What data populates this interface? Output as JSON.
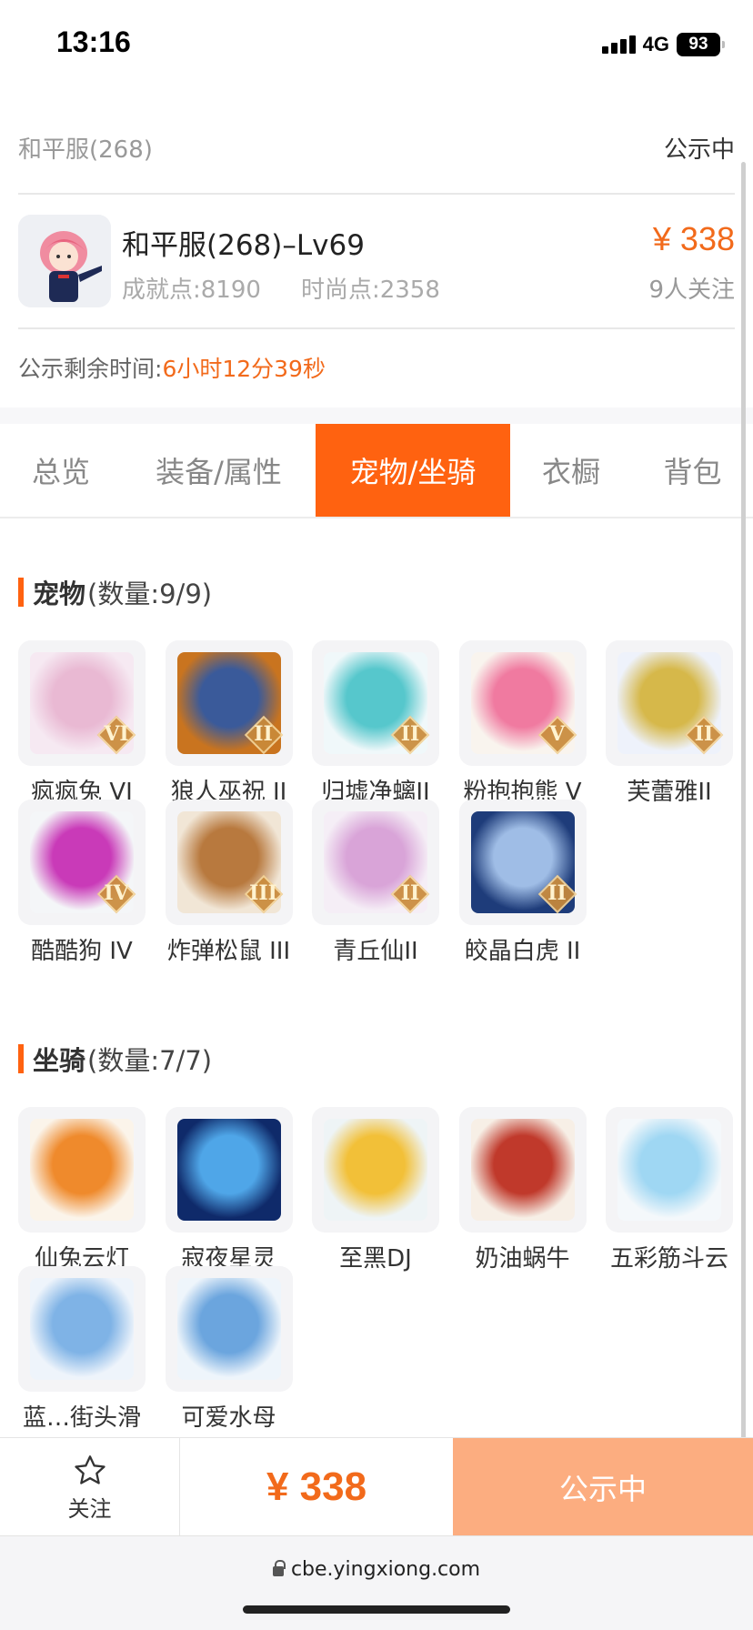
{
  "status_bar": {
    "time": "13:16",
    "network": "4G",
    "battery": "93"
  },
  "listing": {
    "server": "和平服(268)",
    "status": "公示中",
    "character": {
      "name": "和平服(268)–Lv69",
      "achievement_points": "成就点:8190",
      "fashion_points": "时尚点:2358",
      "price": "¥ 338",
      "followers": "9人关注"
    },
    "remaining_label": "公示剩余时间:",
    "remaining_value": "6小时12分39秒"
  },
  "tabs": [
    {
      "label": "总览",
      "active": false
    },
    {
      "label": "装备/属性",
      "active": false
    },
    {
      "label": "宠物/坐骑",
      "active": true
    },
    {
      "label": "衣橱",
      "active": false
    },
    {
      "label": "背包",
      "active": false
    }
  ],
  "pets": {
    "title": "宠物",
    "count": "(数量:9/9)",
    "items": [
      {
        "name": "疯疯兔 VI",
        "badge": "VI",
        "icon": "pink-rabbit-icon",
        "colors": [
          "#f6e9f2",
          "#e9b9d3"
        ]
      },
      {
        "name": "狼人巫祝 II",
        "badge": "II",
        "icon": "werewolf-shaman-icon",
        "colors": [
          "#c9741f",
          "#3a5a9a"
        ]
      },
      {
        "name": "归墟净螭II",
        "badge": "II",
        "icon": "jade-dragon-icon",
        "colors": [
          "#f0f8fa",
          "#56c7cc"
        ]
      },
      {
        "name": "粉抱抱熊 V",
        "badge": "V",
        "icon": "pink-bear-icon",
        "colors": [
          "#f9f4ee",
          "#f07aa0"
        ]
      },
      {
        "name": "芙蕾雅II",
        "badge": "II",
        "icon": "valkyrie-icon",
        "colors": [
          "#eef2fb",
          "#d6b84a"
        ]
      },
      {
        "name": "酷酷狗 IV",
        "badge": "IV",
        "icon": "cool-dog-icon",
        "colors": [
          "#f4f6f8",
          "#c93ab8"
        ]
      },
      {
        "name": "炸弹松鼠 III",
        "badge": "III",
        "icon": "bomb-squirrel-icon",
        "colors": [
          "#f1e6d6",
          "#b8793e"
        ]
      },
      {
        "name": "青丘仙II",
        "badge": "II",
        "icon": "fox-fairy-icon",
        "colors": [
          "#f5eef6",
          "#d9a4d8"
        ]
      },
      {
        "name": "皎晶白虎 II",
        "badge": "II",
        "icon": "white-tiger-icon",
        "colors": [
          "#1e3c7a",
          "#9fbde6"
        ]
      }
    ]
  },
  "mounts": {
    "title": "坐骑",
    "count": "(数量:7/7)",
    "items": [
      {
        "name": "仙兔云灯",
        "icon": "rabbit-lantern-icon",
        "colors": [
          "#fbf4ea",
          "#ef8a2c"
        ]
      },
      {
        "name": "寂夜星灵",
        "icon": "night-star-deer-icon",
        "colors": [
          "#0f2a6a",
          "#4fa6e8"
        ]
      },
      {
        "name": "至黑DJ",
        "icon": "dj-penguin-icon",
        "colors": [
          "#eef4f6",
          "#f2c038"
        ]
      },
      {
        "name": "奶油蜗牛",
        "icon": "cream-snail-icon",
        "colors": [
          "#f7efe6",
          "#c0392b"
        ]
      },
      {
        "name": "五彩筋斗云",
        "icon": "cloud-icon",
        "colors": [
          "#f4f8fb",
          "#9fd7f3"
        ]
      },
      {
        "name": "蓝…街头滑",
        "icon": "skateboard-icon",
        "colors": [
          "#eef4fb",
          "#7fb3e6"
        ]
      },
      {
        "name": "可爱水母",
        "icon": "jellyfish-icon",
        "colors": [
          "#eef5fb",
          "#6ba5de"
        ]
      }
    ]
  },
  "bottom_bar": {
    "follow_label": "关注",
    "price": "¥ 338",
    "action_label": "公示中"
  },
  "browser": {
    "url": "cbe.yingxiong.com"
  },
  "colors": {
    "accent": "#ff6210",
    "price": "#f26a1b",
    "disabled_button": "#fcad80"
  }
}
